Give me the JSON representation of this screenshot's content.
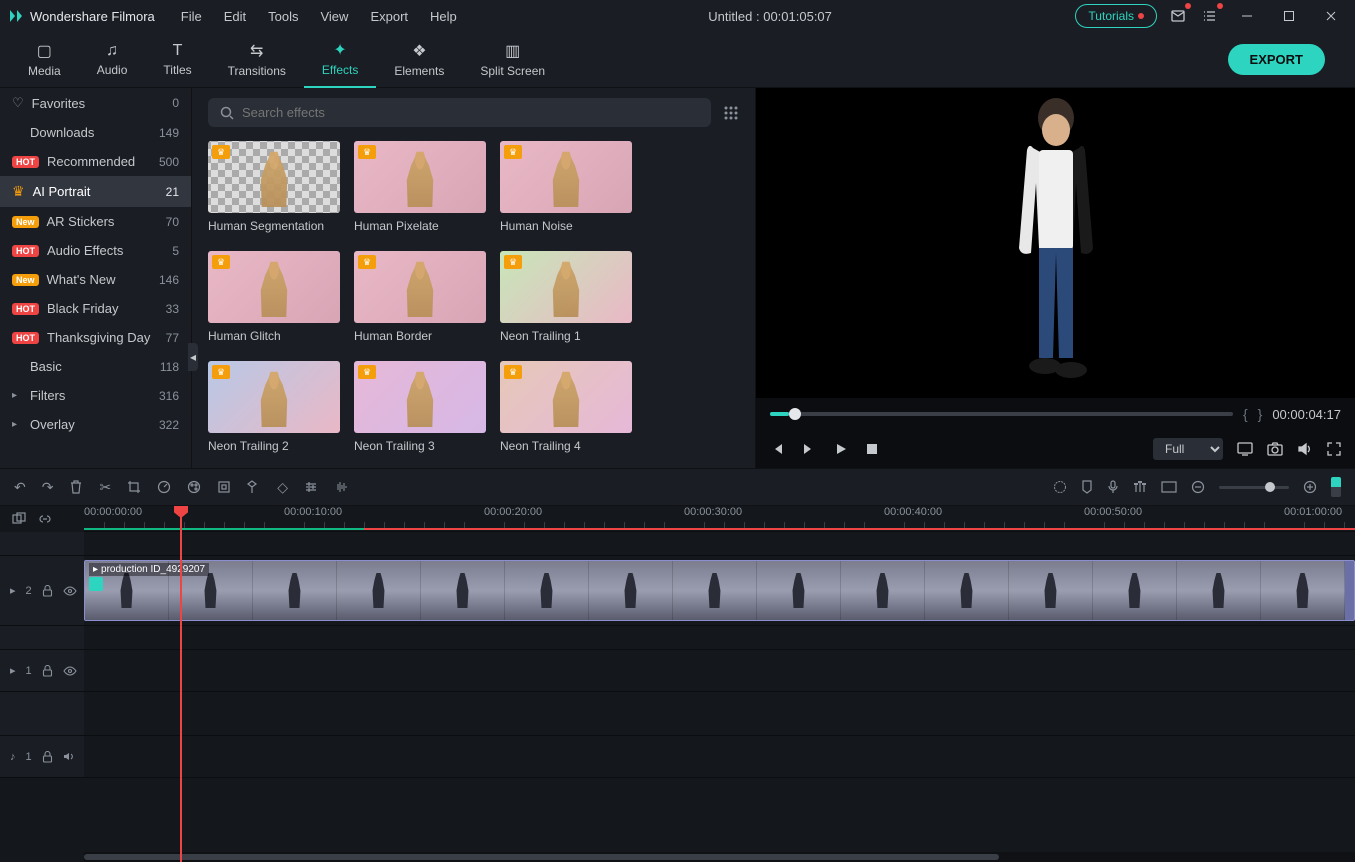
{
  "app": {
    "name": "Wondershare Filmora",
    "title_center": "Untitled : 00:01:05:07",
    "tutorials": "Tutorials"
  },
  "menu": {
    "file": "File",
    "edit": "Edit",
    "tools": "Tools",
    "view": "View",
    "export": "Export",
    "help": "Help"
  },
  "tabs": {
    "media": "Media",
    "audio": "Audio",
    "titles": "Titles",
    "transitions": "Transitions",
    "effects": "Effects",
    "elements": "Elements",
    "split_screen": "Split Screen",
    "export_btn": "EXPORT"
  },
  "search": {
    "placeholder": "Search effects"
  },
  "sidebar": {
    "items": [
      {
        "label": "Favorites",
        "count": "0",
        "icon": "heart"
      },
      {
        "label": "Downloads",
        "count": "149",
        "icon": "none"
      },
      {
        "label": "Recommended",
        "count": "500",
        "badge": "HOT"
      },
      {
        "label": "AI Portrait",
        "count": "21",
        "icon": "crown",
        "active": true
      },
      {
        "label": "AR Stickers",
        "count": "70",
        "badge": "New"
      },
      {
        "label": "Audio Effects",
        "count": "5",
        "badge": "HOT"
      },
      {
        "label": "What's New",
        "count": "146",
        "badge": "New"
      },
      {
        "label": "Black Friday",
        "count": "33",
        "badge": "HOT"
      },
      {
        "label": "Thanksgiving Day",
        "count": "77",
        "badge": "HOT"
      },
      {
        "label": "Basic",
        "count": "118",
        "icon": "none"
      },
      {
        "label": "Filters",
        "count": "316",
        "icon": "expand"
      },
      {
        "label": "Overlay",
        "count": "322",
        "icon": "expand"
      }
    ]
  },
  "effects": [
    {
      "name": "Human Segmentation",
      "style": "checker"
    },
    {
      "name": "Human Pixelate",
      "style": ""
    },
    {
      "name": "Human Noise",
      "style": ""
    },
    {
      "name": "Human Glitch",
      "style": ""
    },
    {
      "name": "Human Border",
      "style": ""
    },
    {
      "name": "Neon Trailing 1",
      "style": "neon1"
    },
    {
      "name": "Neon Trailing 2",
      "style": "neon2"
    },
    {
      "name": "Neon Trailing 3",
      "style": "neon3"
    },
    {
      "name": "Neon Trailing 4",
      "style": "neon4"
    }
  ],
  "preview": {
    "time": "00:00:04:17",
    "quality": "Full"
  },
  "timeline": {
    "ticks": [
      "00:00:00:00",
      "00:00:10:00",
      "00:00:20:00",
      "00:00:30:00",
      "00:00:40:00",
      "00:00:50:00",
      "00:01:00:00"
    ],
    "track_video2": "2",
    "track_video1": "1",
    "track_audio1": "1",
    "clip_name": "production ID_4929207"
  }
}
